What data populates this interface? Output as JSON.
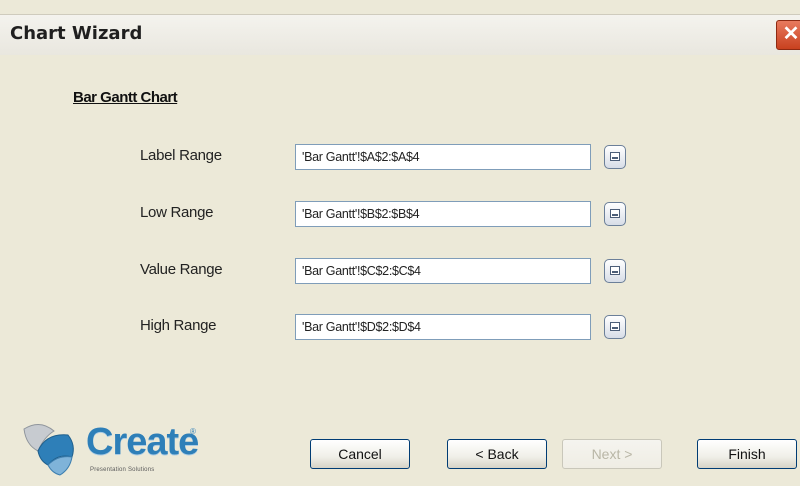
{
  "window": {
    "title": "Chart Wizard",
    "close_label": "✕"
  },
  "section_heading": "Bar Gantt Chart",
  "ranges": [
    {
      "label": "Label Range",
      "value": "'Bar Gantt'!$A$2:$A$4"
    },
    {
      "label": "Low Range",
      "value": "'Bar Gantt'!$B$2:$B$4"
    },
    {
      "label": "Value Range",
      "value": "'Bar Gantt'!$C$2:$C$4"
    },
    {
      "label": "High Range",
      "value": "'Bar Gantt'!$D$2:$D$4"
    }
  ],
  "logo": {
    "name": "Create",
    "tm": "®",
    "tagline": "Presentation Solutions"
  },
  "buttons": {
    "cancel": "Cancel",
    "back": "< Back",
    "next": "Next >",
    "finish": "Finish"
  },
  "icons": {
    "range_selector": "range-select-icon",
    "close": "close-icon",
    "logo": "create-logo-icon"
  },
  "colors": {
    "accent": "#2e7fb8",
    "close": "#c8411f"
  }
}
